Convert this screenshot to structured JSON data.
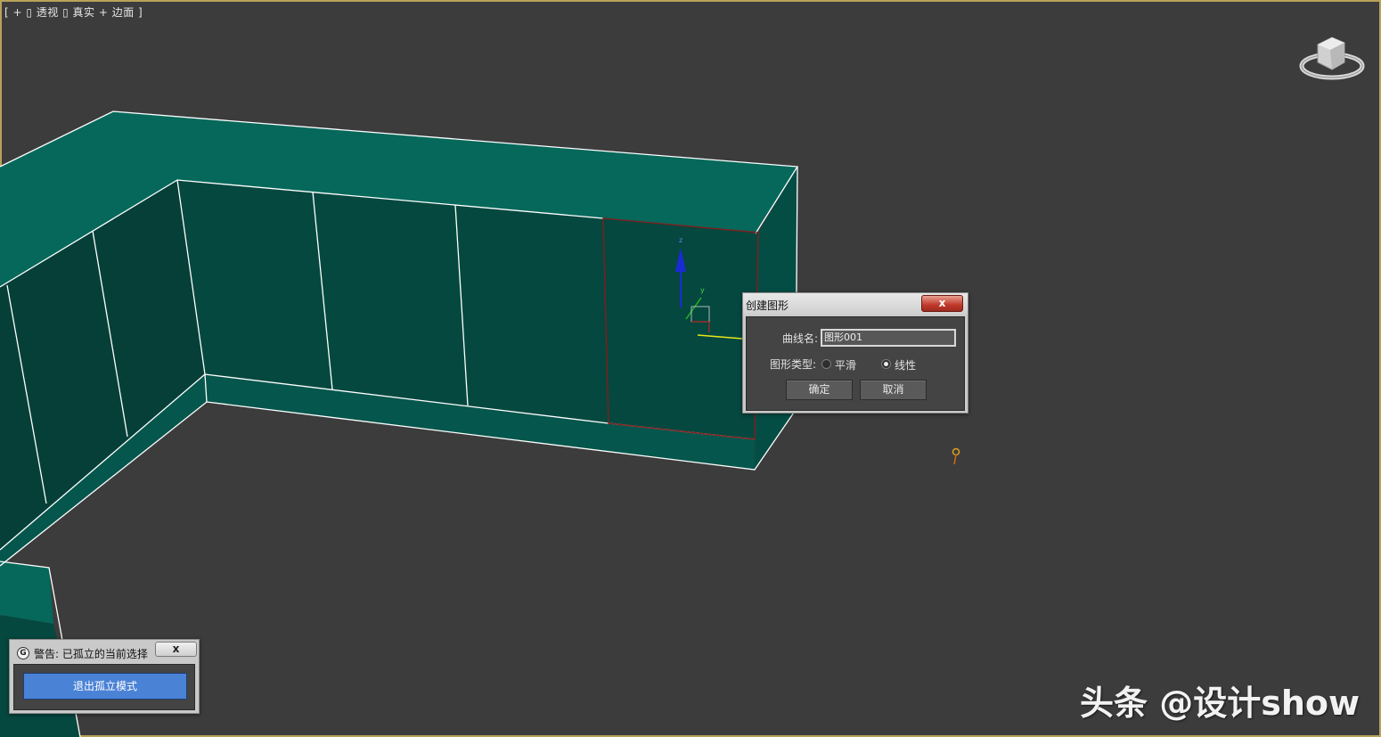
{
  "viewport": {
    "label": "[ + ▯ 透视 ▯ 真实 + 边面 ]"
  },
  "create_shape_dialog": {
    "title": "创建图形",
    "close_label": "x",
    "curve_name_label": "曲线名:",
    "curve_name_value": "图形001",
    "shape_type_label": "图形类型:",
    "options": [
      {
        "label": "平滑",
        "selected": false
      },
      {
        "label": "线性",
        "selected": true
      }
    ],
    "ok_label": "确定",
    "cancel_label": "取消"
  },
  "isolation_warning": {
    "title": "警告: 已孤立的当前选择",
    "close_label": "x",
    "exit_button_label": "退出孤立模式"
  },
  "gizmo": {
    "z_label": "z",
    "y_label": "y"
  },
  "watermark": "头条 @设计show",
  "colors": {
    "background": "#3c3c3c",
    "cabinet_top": "#05685a",
    "cabinet_face": "#05483f",
    "edge_highlight": "#ffffff",
    "selection_edge": "#8b1a1a",
    "accent_button": "#4a82d6"
  }
}
